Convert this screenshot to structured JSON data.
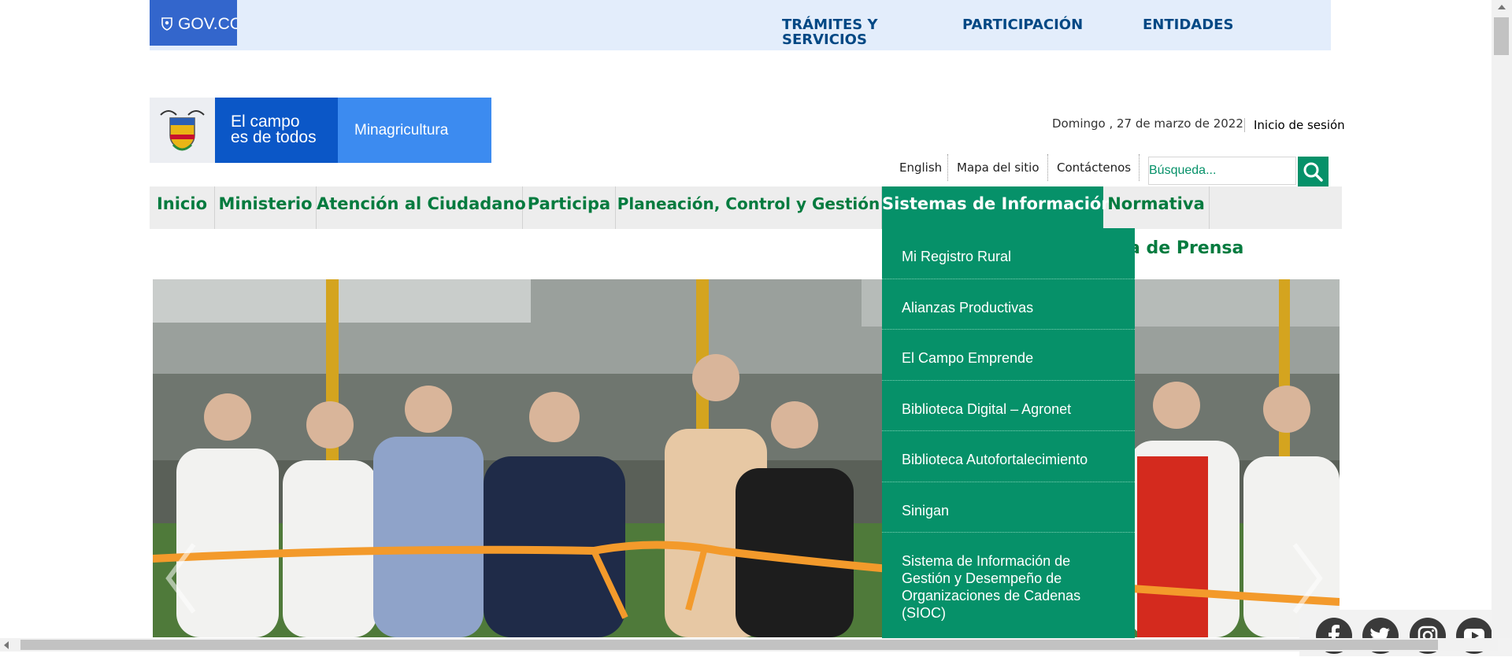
{
  "gov_bar": {
    "logo_text": "GOV.CO",
    "links": [
      "TRÁMITES Y SERVICIOS",
      "PARTICIPACIÓN",
      "ENTIDADES"
    ]
  },
  "brand": {
    "slogan": "El campo es de todos",
    "ministry": "Minagricultura"
  },
  "header": {
    "date": "Domingo , 27 de marzo de 2022",
    "login": "Inicio de sesión",
    "utility_links": [
      "English",
      "Mapa del sitio",
      "Contáctenos"
    ],
    "search_placeholder": "Búsqueda..."
  },
  "nav": {
    "items": [
      "Inicio",
      "Ministerio",
      "Atención al Ciudadano",
      "Participa",
      "Planeación, Control y Gestión",
      "Sistemas de Información",
      "Normativa"
    ],
    "active": "Sistemas de Información"
  },
  "dropdown": {
    "items": [
      "Mi Registro Rural",
      "Alianzas Productivas",
      "El Campo Emprende",
      "Biblioteca Digital – Agronet",
      "Biblioteca Autofortalecimiento",
      "Sinigan",
      "Sistema de Información de Gestión y Desempeño de Organizaciones de Cadenas (SIOC)"
    ]
  },
  "subnav": {
    "partial_label": "a de Prensa"
  },
  "social": [
    "facebook-icon",
    "twitter-icon",
    "instagram-icon",
    "youtube-icon"
  ],
  "colors": {
    "gov_blue": "#3366cc",
    "gov_bar_bg": "#e3edfb",
    "green": "#069169",
    "nav_text_green": "#047b3f"
  }
}
